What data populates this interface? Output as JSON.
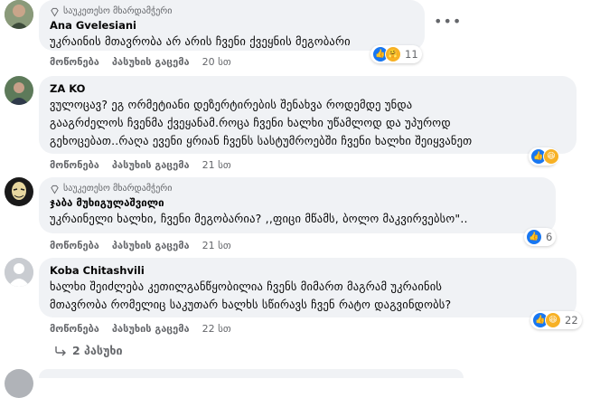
{
  "comments": [
    {
      "badge": "საუკეთესო მხარდამჭერი",
      "author": "Ana Gvelesiani",
      "text": "უკრაინის მთავრობა არ არის ჩვენი ქვეყნის მეგობარი",
      "like": "მოწონება",
      "reply": "პასუხის გაცემა",
      "time": "20 სთ",
      "reaction_count": "11",
      "reactions": [
        "like-icon",
        "hug-icon"
      ]
    },
    {
      "badge": "",
      "author": "ZA KO",
      "text": "ვულოცავ? ეგ ორმეტიანი დეზერტირების შენახვა როდემდე უნდა\nგააგრძელოს ჩვენმა ქვეყანამ.როცა ჩვენი ხალხი უწამლოდ და უპუროდ\nგეხოცებათ..რაღა ევენი ყრიან ჩვენს სასტუმროებში ჩვენი ხალხი შეიყვანეთ",
      "like": "მოწონება",
      "reply": "პასუხის გაცემა",
      "time": "21 სთ",
      "reaction_count": "",
      "reactions": [
        "like-icon",
        "haha-icon"
      ]
    },
    {
      "badge": "საუკეთესო მხარდამჭერი",
      "author": "ჯაბა მუხიგულაშვილი",
      "text": "უკრაინელი ხალხი, ჩვენი მეგობარია? ,,ფიცი მწამს, ბოლო მაკვირვებსო\"..",
      "like": "მოწონება",
      "reply": "პასუხის გაცემა",
      "time": "21 სთ",
      "reaction_count": "6",
      "reactions": [
        "like-icon"
      ]
    },
    {
      "badge": "",
      "author": "Koba Chitashvili",
      "text": "ხალხი შეიძლება კეთილგანწყობილია ჩვენს მიმართ მაგრამ უკრაინის\nმთავრობა რომელიც საკუთარ ხალხს სწირავს ჩვენ რატო დაგვინდობს?",
      "like": "მოწონება",
      "reply": "პასუხის გაცემა",
      "time": "22 სთ",
      "reaction_count": "22",
      "reactions": [
        "like-icon",
        "haha-icon"
      ]
    }
  ],
  "replies_label": "2 პასუხი",
  "colors": {
    "like": "#1877f2",
    "haha": "#f7b125",
    "bubble": "#f0f2f5",
    "muted": "#65676b"
  }
}
